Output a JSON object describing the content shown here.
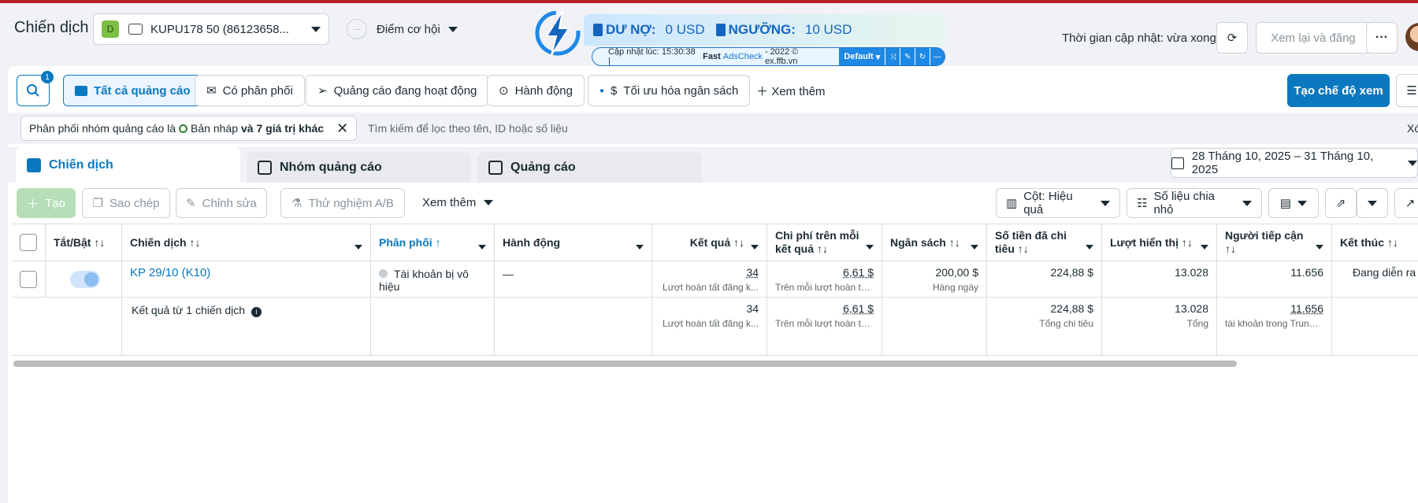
{
  "header": {
    "title": "Chiến dịch",
    "account_badge": "D",
    "account_label": "KUPU178 50 (86123658...",
    "opportunity_icon": "···",
    "opportunity_label": "Điểm cơ hội",
    "update_text": "Thời gian cập nhật: vừa xong",
    "review_button": "Xem lại và đăng",
    "more_button": "···"
  },
  "extension": {
    "debt_label": "DƯ NỢ:",
    "debt_value": "0 USD",
    "threshold_label": "NGƯỠNG:",
    "threshold_value": "10 USD",
    "updated_prefix": "Cập nhật lúc: 15:30:38 |",
    "fast": "Fast",
    "adscheck": "AdsCheck",
    "suffix": "- 2022 © ex.ffb.vn",
    "mode": "Default"
  },
  "filter_bar": {
    "search_badge": "1",
    "chips": [
      "Tất cả quảng cáo",
      "Có phân phối",
      "Quảng cáo đang hoạt động",
      "Hành động",
      "Tối ưu hóa ngân sách"
    ],
    "more": "Xem thêm",
    "create_view": "Tạo chế độ xem"
  },
  "active_filter": {
    "text": "Phân phối nhóm quảng cáo là",
    "value": "Bản nháp",
    "extra": "và 7 giá trị khác",
    "search_placeholder": "Tìm kiếm để lọc theo tên, ID hoặc số liệu",
    "clear": "Xóa"
  },
  "tabs": [
    "Chiến dịch",
    "Nhóm quảng cáo",
    "Quảng cáo"
  ],
  "date_range": "28 Tháng 10, 2025 – 31 Tháng 10, 2025",
  "toolbar": {
    "create": "Tạo",
    "copy": "Sao chép",
    "edit": "Chỉnh sửa",
    "ab_test": "Thử nghiệm A/B",
    "more": "Xem thêm",
    "columns": "Cột: Hiệu quả",
    "breakdown": "Số liệu chia nhỏ"
  },
  "table": {
    "headers": {
      "toggle": "Tắt/Bật ↑↓",
      "campaign": "Chiến dịch ↑↓",
      "delivery": "Phân phối ↑",
      "action": "Hành động",
      "results": "Kết quả ↑↓",
      "cost_per_result": "Chi phí trên mỗi kết quả ↑↓",
      "budget": "Ngân sách ↑↓",
      "amount_spent": "Số tiền đã chi tiêu ↑↓",
      "impressions": "Lượt hiển thị ↑↓",
      "reach": "Người tiếp cận ↑↓",
      "ends": "Kết thúc ↑↓"
    },
    "row": {
      "campaign": "KP 29/10 (K10)",
      "delivery": "Tài khoản bị vô hiệu",
      "action": "—",
      "results": "34",
      "results_sub": "Lượt hoàn tất đăng k...",
      "cost": "6,61 $",
      "cost_sub": "Trên mỗi lượt hoàn tấ...",
      "budget": "200,00 $",
      "budget_sub": "Hàng ngày",
      "spent": "224,88 $",
      "impressions": "13.028",
      "reach": "11.656",
      "ends": "Đang diễn ra"
    },
    "summary": {
      "label": "Kết quả từ 1 chiến dịch",
      "results": "34",
      "results_sub": "Lượt hoàn tất đăng k...",
      "cost": "6,61 $",
      "cost_sub": "Trên mỗi lượt hoàn tấ...",
      "spent": "224,88 $",
      "spent_sub": "Tổng chi tiêu",
      "impressions": "13.028",
      "impressions_sub": "Tổng",
      "reach": "11.656",
      "reach_sub": "tài khoản trong Trung ..."
    }
  },
  "colors": {
    "primary": "#0a78be",
    "topline": "#b8202a",
    "badge_green": "#7bc043"
  }
}
